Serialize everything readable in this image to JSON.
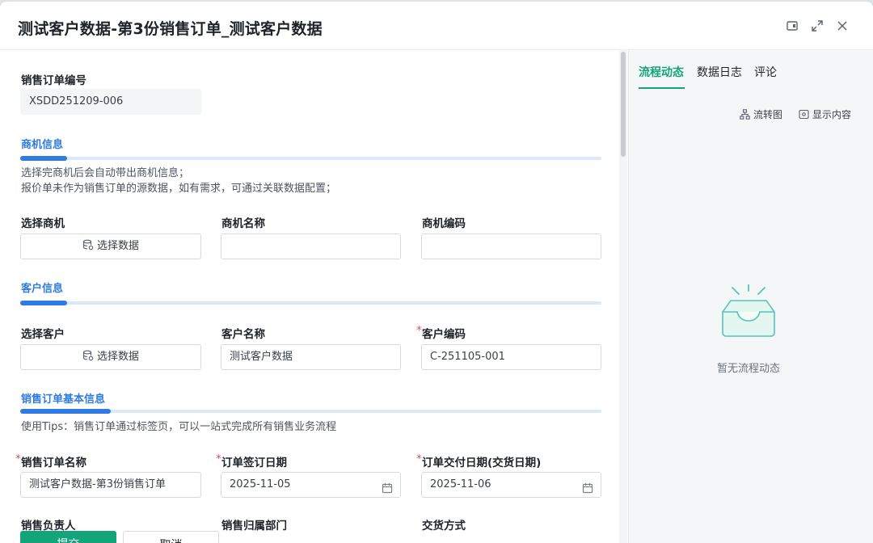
{
  "window": {
    "title": "测试客户数据-第3份销售订单_测试客户数据"
  },
  "form": {
    "order_no": {
      "label": "销售订单编号",
      "value": "XSDD251209-006"
    },
    "opportunity_section": {
      "title": "商机信息",
      "notes": [
        "选择完商机后会自动带出商机信息；",
        "报价单未作为销售订单的源数据，如有需求，可通过关联数据配置；"
      ],
      "select_label": "选择商机",
      "select_button": "选择数据",
      "name_label": "商机名称",
      "name_value": "",
      "code_label": "商机编码",
      "code_value": ""
    },
    "customer_section": {
      "title": "客户信息",
      "select_label": "选择客户",
      "select_button": "选择数据",
      "name_label": "客户名称",
      "name_value": "测试客户数据",
      "code_label": "客户编码",
      "code_value": "C-251105-001"
    },
    "basic_section": {
      "title": "销售订单基本信息",
      "tip": "使用Tips：销售订单通过标签页，可以一站式完成所有销售业务流程",
      "order_name_label": "销售订单名称",
      "order_name_value": "测试客户数据-第3份销售订单",
      "sign_date_label": "订单签订日期",
      "sign_date_value": "2025-11-05",
      "delivery_date_label": "订单交付日期(交货日期)",
      "delivery_date_value": "2025-11-06",
      "owner_label": "销售负责人",
      "dept_label": "销售归属部门",
      "delivery_method_label": "交货方式"
    }
  },
  "footer": {
    "submit": "提交",
    "cancel": "取消"
  },
  "side_panel": {
    "tabs": [
      "流程动态",
      "数据日志",
      "评论"
    ],
    "active_tab": "流程动态",
    "flowchart": "流转图",
    "show_content": "显示内容",
    "empty": "暂无流程动态"
  },
  "colors": {
    "primary": "#13a57a",
    "section_blue": "#2f7be5",
    "required": "#e34d59"
  },
  "icons": [
    "minimize-icon",
    "maximize-icon",
    "close-icon",
    "database-icon",
    "calendar-icon",
    "flowchart-icon",
    "eye-icon",
    "empty-inbox-icon"
  ]
}
